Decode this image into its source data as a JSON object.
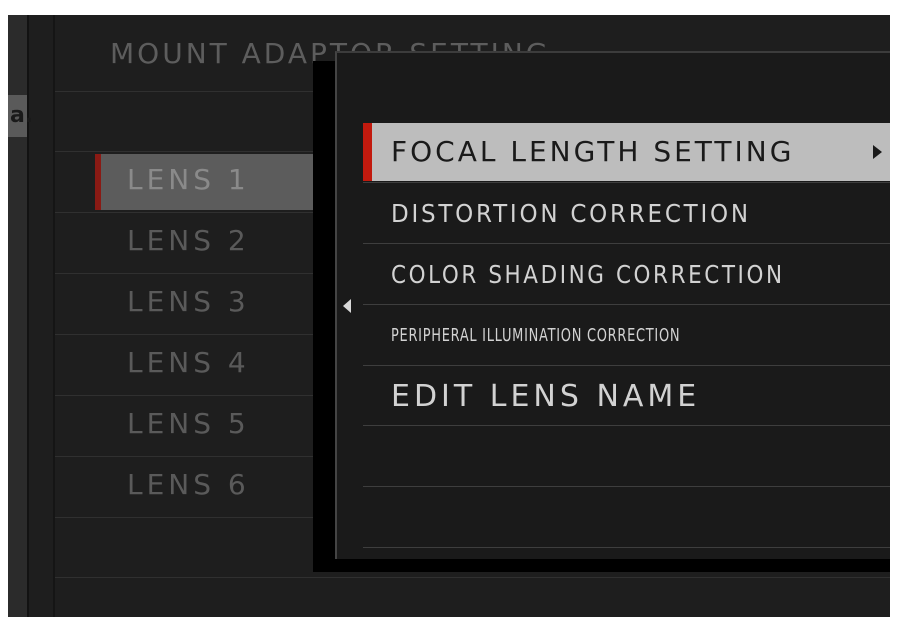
{
  "background": {
    "title": "MOUNT ADAPTOR SETTING",
    "side_tab_glyph": "a."
  },
  "lens_list": [
    {
      "label": "LENS 1",
      "selected": true
    },
    {
      "label": "LENS 2",
      "selected": false
    },
    {
      "label": "LENS 3",
      "selected": false
    },
    {
      "label": "LENS 4",
      "selected": false
    },
    {
      "label": "LENS 5",
      "selected": false
    },
    {
      "label": "LENS 6",
      "selected": false
    }
  ],
  "submenu": {
    "back_icon": "triangle-left",
    "items": [
      {
        "label": "FOCAL LENGTH SETTING",
        "selected": true,
        "has_submenu": true
      },
      {
        "label": "DISTORTION CORRECTION",
        "selected": false
      },
      {
        "label": "COLOR SHADING CORRECTION",
        "selected": false
      },
      {
        "label": "PERIPHERAL ILLUMINATION CORRECTION",
        "selected": false
      },
      {
        "label": "EDIT LENS NAME",
        "selected": false
      }
    ]
  },
  "colors": {
    "accent_red": "#c21a0e",
    "selected_row_bg": "#bdbdbd",
    "background": "#1e1e1e"
  }
}
